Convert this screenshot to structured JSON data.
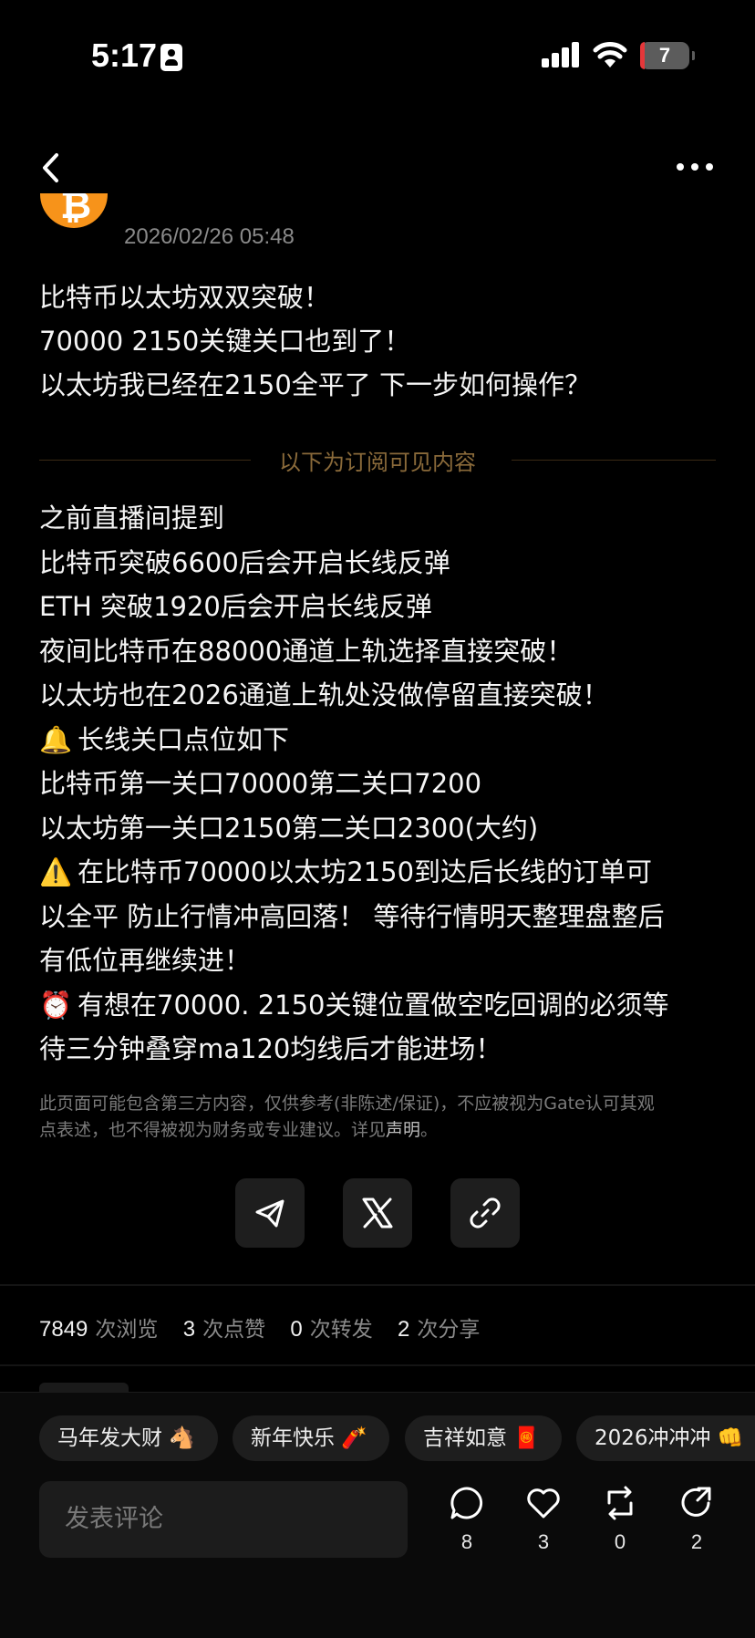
{
  "status_bar": {
    "time": "5:17",
    "battery": "7"
  },
  "post": {
    "timestamp": "2026/02/26 05:48",
    "title_lines": [
      "比特币以太坊双双突破！",
      "70000 2150关键关口也到了！",
      "以太坊我已经在2150全平了 下一步如何操作？"
    ],
    "subscriber_divider": "以下为订阅可见内容",
    "body": [
      {
        "icon": "",
        "text": "之前直播间提到"
      },
      {
        "icon": "",
        "text": "比特币突破6600后会开启长线反弹"
      },
      {
        "icon": "",
        "text": "ETH 突破1920后会开启长线反弹"
      },
      {
        "icon": "",
        "text": "夜间比特币在88000通道上轨选择直接突破！"
      },
      {
        "icon": "",
        "text": "以太坊也在2026通道上轨处没做停留直接突破！"
      },
      {
        "icon": "🔔",
        "text": "长线关口点位如下"
      },
      {
        "icon": "",
        "text": "比特币第一关口70000第二关口7200"
      },
      {
        "icon": "",
        "text": "以太坊第一关口2150第二关口2300(大约)"
      },
      {
        "icon": "⚠️",
        "text": "在比特币70000以太坊2150到达后长线的订单可"
      },
      {
        "icon": "",
        "text": "以全平 防止行情冲高回落！ 等待行情明天整理盘整后"
      },
      {
        "icon": "",
        "text": "有低位再继续进！"
      },
      {
        "icon": "⏰",
        "text": "有想在70000. 2150关键位置做空吃回调的必须等"
      },
      {
        "icon": "",
        "text": "待三分钟叠穿ma120均线后才能进场！"
      }
    ],
    "disclaimer": {
      "line1": "此页面可能包含第三方内容，仅供参考(非陈述/保证)，不应被视为Gate认可其观",
      "line2_pre": "点表述，也不得被视为财务或专业建议。详见",
      "link": "声明",
      "line2_post": "。"
    },
    "avatar_glyph": "₿"
  },
  "stats": {
    "views": "7849",
    "views_label": "次浏览",
    "likes": "3",
    "likes_label": "次点赞",
    "reposts": "0",
    "reposts_label": "次转发",
    "shares": "2",
    "shares_label": "次分享"
  },
  "tags": [
    "马年发大财 🐴",
    "新年快乐 🧨",
    "吉祥如意 🧧",
    "2026冲冲冲 👊"
  ],
  "comment": {
    "placeholder": "发表评论"
  },
  "actions": {
    "comments": "8",
    "likes": "3",
    "reposts": "0",
    "shares": "2"
  },
  "colors": {
    "accent_divider": "#8a6a3a",
    "bitcoin": "#f7931a",
    "battery_low": "#e5373a"
  }
}
